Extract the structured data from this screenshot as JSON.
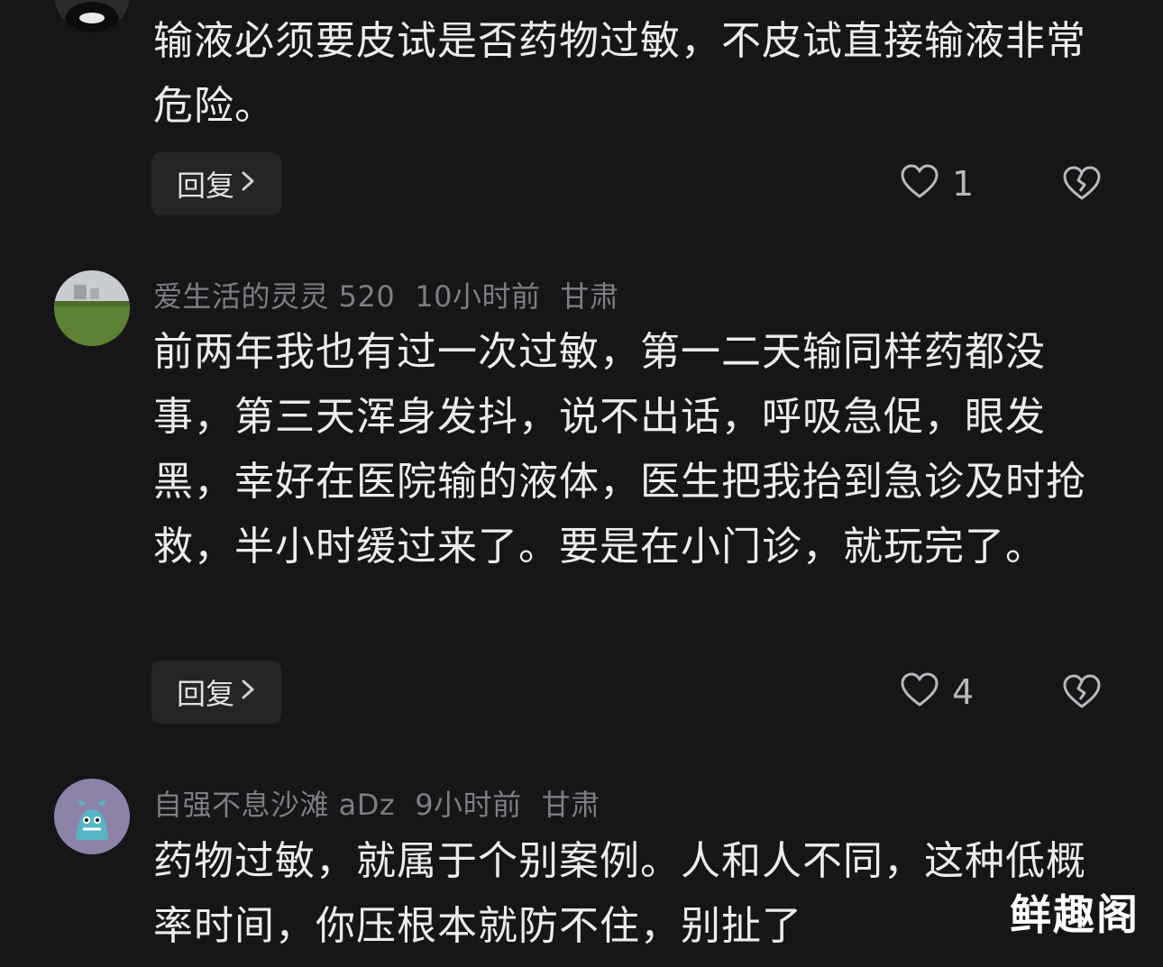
{
  "comments": [
    {
      "text": "输液必须要皮试是否药物过敏，不皮试直接输液非常危险。",
      "reply_label": "回复",
      "likes": "1"
    },
    {
      "username": "爱生活的灵灵 520",
      "time": "10小时前",
      "location": "甘肃",
      "text": "前两年我也有过一次过敏，第一二天输同样药都没事，第三天浑身发抖，说不出话，呼吸急促，眼发黑，幸好在医院输的液体，医生把我抬到急诊及时抢救，半小时缓过来了。要是在小门诊，就玩完了。",
      "reply_label": "回复",
      "likes": "4"
    },
    {
      "username": "自强不息沙滩 aDz",
      "time": "9小时前",
      "location": "甘肃",
      "text": "药物过敏，就属于个别案例。人和人不同，这种低概率时间，你压根本就防不住，别扯了"
    }
  ],
  "icons": {
    "reply_chevron": "chevron-right-icon",
    "like": "heart-outline-icon",
    "dislike": "broken-heart-icon"
  },
  "watermark": "鲜趣阁",
  "colors": {
    "background": "#161618",
    "text": "#ececef",
    "meta": "#7d7d82",
    "button_bg": "#252528"
  }
}
